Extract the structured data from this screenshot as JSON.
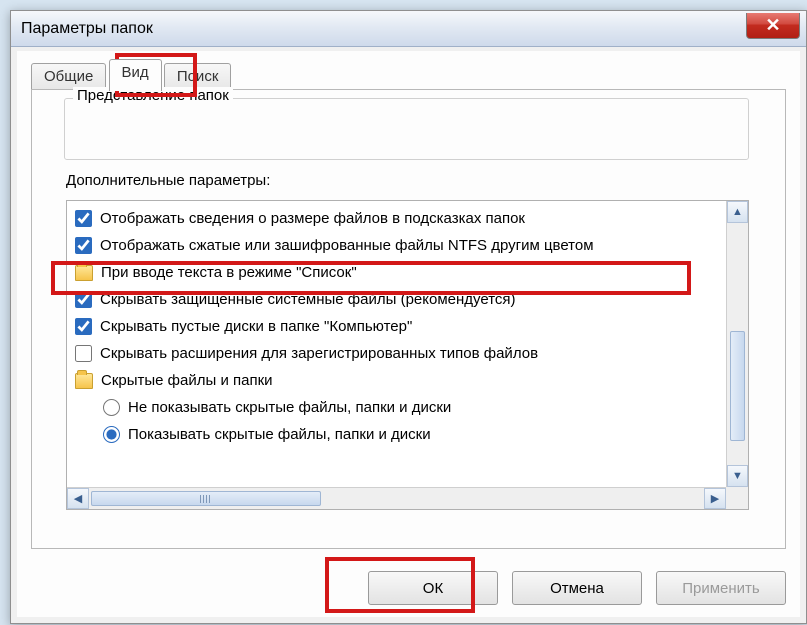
{
  "window": {
    "title": "Параметры папок"
  },
  "tabs": {
    "general": "Общие",
    "view": "Вид",
    "search": "Поиск"
  },
  "groupbox": {
    "legend": "Представление папок"
  },
  "advanced_label": "Дополнительные параметры:",
  "items": [
    {
      "type": "check",
      "checked": true,
      "label": "Отображать сведения о размере файлов в подсказках папок"
    },
    {
      "type": "check",
      "checked": true,
      "label": "Отображать сжатые или зашифрованные файлы NTFS другим цветом"
    },
    {
      "type": "folder",
      "label": "При вводе текста в режиме \"Список\""
    },
    {
      "type": "check",
      "checked": true,
      "label": "Скрывать защищенные системные файлы (рекомендуется)"
    },
    {
      "type": "check",
      "checked": true,
      "label": "Скрывать пустые диски в папке \"Компьютер\""
    },
    {
      "type": "check",
      "checked": false,
      "label": "Скрывать расширения для зарегистрированных типов файлов"
    },
    {
      "type": "folder",
      "label": "Скрытые файлы и папки"
    },
    {
      "type": "radio",
      "checked": false,
      "indent": true,
      "label": "Не показывать скрытые файлы, папки и диски"
    },
    {
      "type": "radio",
      "checked": true,
      "indent": true,
      "label": "Показывать скрытые файлы, папки и диски"
    }
  ],
  "buttons": {
    "ok": "ОК",
    "cancel": "Отмена",
    "apply": "Применить"
  }
}
